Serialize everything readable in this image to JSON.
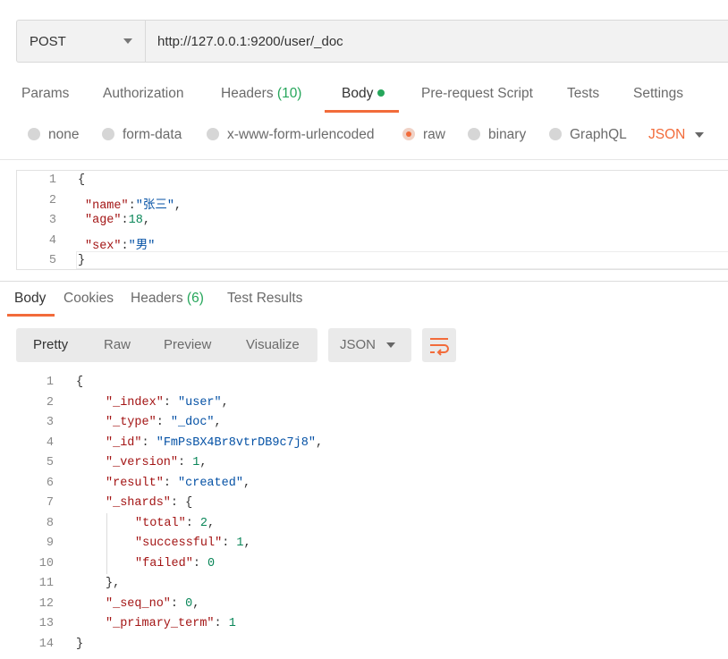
{
  "request": {
    "method": "POST",
    "url": "http://127.0.0.1:9200/user/_doc"
  },
  "request_tabs": {
    "params": "Params",
    "authorization": "Authorization",
    "headers": "Headers",
    "headers_count": "(10)",
    "body": "Body",
    "prerequest": "Pre-request Script",
    "tests": "Tests",
    "settings": "Settings"
  },
  "body_types": {
    "none": "none",
    "form_data": "form-data",
    "urlencoded": "x-www-form-urlencoded",
    "raw": "raw",
    "binary": "binary",
    "graphql": "GraphQL",
    "selected_format": "JSON"
  },
  "request_body": {
    "line_numbers": [
      "1",
      "2",
      "3",
      "4",
      "5"
    ],
    "open_brace": "{",
    "close_brace": "}",
    "fields": [
      {
        "key": "\"name\"",
        "sep": ":",
        "value": "\"张三\"",
        "trail": ","
      },
      {
        "key": "\"age\"",
        "sep": ":",
        "value": "18",
        "trail": ","
      },
      {
        "key": "\"sex\"",
        "sep": ":",
        "value": "\"男\"",
        "trail": ""
      }
    ]
  },
  "response_tabs": {
    "body": "Body",
    "cookies": "Cookies",
    "headers": "Headers",
    "headers_count": "(6)",
    "test_results": "Test Results"
  },
  "response_view": {
    "pretty": "Pretty",
    "raw": "Raw",
    "preview": "Preview",
    "visualize": "Visualize",
    "format": "JSON"
  },
  "response_body": {
    "line_numbers": [
      "1",
      "2",
      "3",
      "4",
      "5",
      "6",
      "7",
      "8",
      "9",
      "10",
      "11",
      "12",
      "13",
      "14"
    ],
    "open_brace": "{",
    "close_brace": "}",
    "index_key": "\"_index\"",
    "index_val": "\"user\"",
    "type_key": "\"_type\"",
    "type_val": "\"_doc\"",
    "id_key": "\"_id\"",
    "id_val": "\"FmPsBX4Br8vtrDB9c7j8\"",
    "version_key": "\"_version\"",
    "version_val": "1",
    "result_key": "\"result\"",
    "result_val": "\"created\"",
    "shards_key": "\"_shards\"",
    "total_key": "\"total\"",
    "total_val": "2",
    "successful_key": "\"successful\"",
    "successful_val": "1",
    "failed_key": "\"failed\"",
    "failed_val": "0",
    "shards_close": "},",
    "seq_key": "\"_seq_no\"",
    "seq_val": "0",
    "term_key": "\"_primary_term\"",
    "term_val": "1"
  },
  "colors": {
    "accent": "#f26b3a",
    "green": "#26a65b",
    "json_key": "#a31515",
    "json_string": "#0451a5",
    "json_number": "#098658"
  }
}
